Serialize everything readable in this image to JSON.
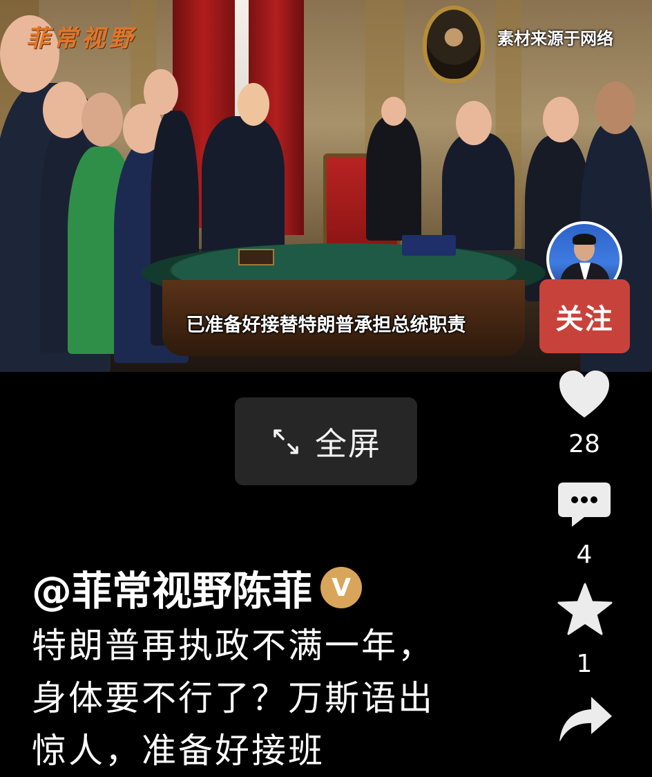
{
  "video": {
    "watermark_logo": "菲常视野",
    "source_label": "素材来源于网络",
    "subtitle": "已准备好接替特朗普承担总统职责"
  },
  "fullscreen": {
    "label": "全屏",
    "icon": "expand-arrows-icon"
  },
  "rail": {
    "follow_label": "关注",
    "likes": "28",
    "comments": "4",
    "favorites": "1",
    "icons": [
      "heart-icon",
      "comment-icon",
      "star-icon",
      "share-icon"
    ]
  },
  "post": {
    "author": "@菲常视野陈菲",
    "verified_badge": "V",
    "caption_lines": [
      "特朗普再执政不满一年，",
      "身体要不行了？万斯语出",
      "惊人，准备好接班"
    ]
  },
  "colors": {
    "follow": "#c8423c",
    "verified": "#d9a55b",
    "background": "#000000"
  }
}
